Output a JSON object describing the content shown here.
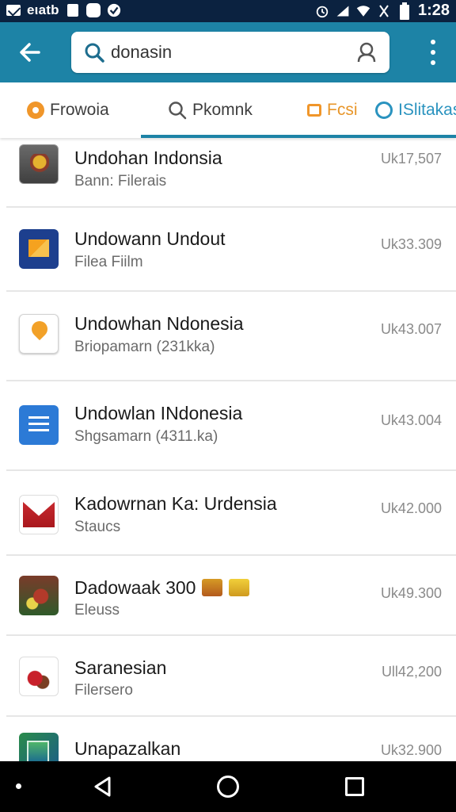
{
  "status_bar": {
    "carrier": "eιatb",
    "time": "1:28",
    "icons": [
      "mail-icon",
      "notification-icon",
      "chat-icon",
      "alarm-icon",
      "signal-icon",
      "wifi-icon",
      "battery-icon"
    ]
  },
  "app_bar": {
    "back_icon": "back-arrow-icon",
    "search": {
      "value": "donasin",
      "placeholder": ""
    },
    "voice_icon": "account-icon",
    "more_icon": "more-vertical-icon"
  },
  "tabs": [
    {
      "label": "Frowoia",
      "icon": "circle-icon"
    },
    {
      "label": "Pkomnk",
      "icon": "search-icon",
      "selected": true
    },
    {
      "label": "Fcsi",
      "icon": "box-icon"
    },
    {
      "label": "ISlitakas",
      "icon": "ring-icon"
    }
  ],
  "list": [
    {
      "title": "Undohan Indonsia",
      "subtitle": "Bann: Filerais",
      "price": "Uk17,507",
      "icon": "emblem-icon"
    },
    {
      "title": "Undowann Undout",
      "subtitle": "Filea Fiilm",
      "price": "Uk33.309",
      "icon": "film-icon"
    },
    {
      "title": "Undowhan Ndonesia",
      "subtitle": "Briopamarn (231kka)",
      "price": "Uk43.007",
      "icon": "map-pin-icon"
    },
    {
      "title": "Undowlan INdonesia",
      "subtitle": "Shgsamarn (4311.ka)",
      "price": "Uk43.004",
      "icon": "docs-icon"
    },
    {
      "title": "Kadowrnan Ka: Urdensia",
      "subtitle": "Staucs",
      "price": "Uk42.000",
      "icon": "mail-icon"
    },
    {
      "title": "Dadowaak 300",
      "subtitle": "Eleuss",
      "price": "Uk49.300",
      "icon": "game-icon"
    },
    {
      "title": "Saranesian",
      "subtitle": "Filersero",
      "price": "Ull42,200",
      "icon": "apple-icon"
    },
    {
      "title": "Unapazalkan",
      "subtitle": "",
      "price": "Uk32.900",
      "icon": "box-icon"
    }
  ],
  "colors": {
    "status_bar": "#0b2240",
    "app_bar": "#1d83a6",
    "tab_accent": "#1d83a6",
    "tab_orange": "#f0962a",
    "tab_blue": "#2a93bf"
  },
  "nav_bar": {
    "icons": [
      "dot-icon",
      "back-triangle-icon",
      "home-circle-icon",
      "recents-square-icon"
    ]
  }
}
